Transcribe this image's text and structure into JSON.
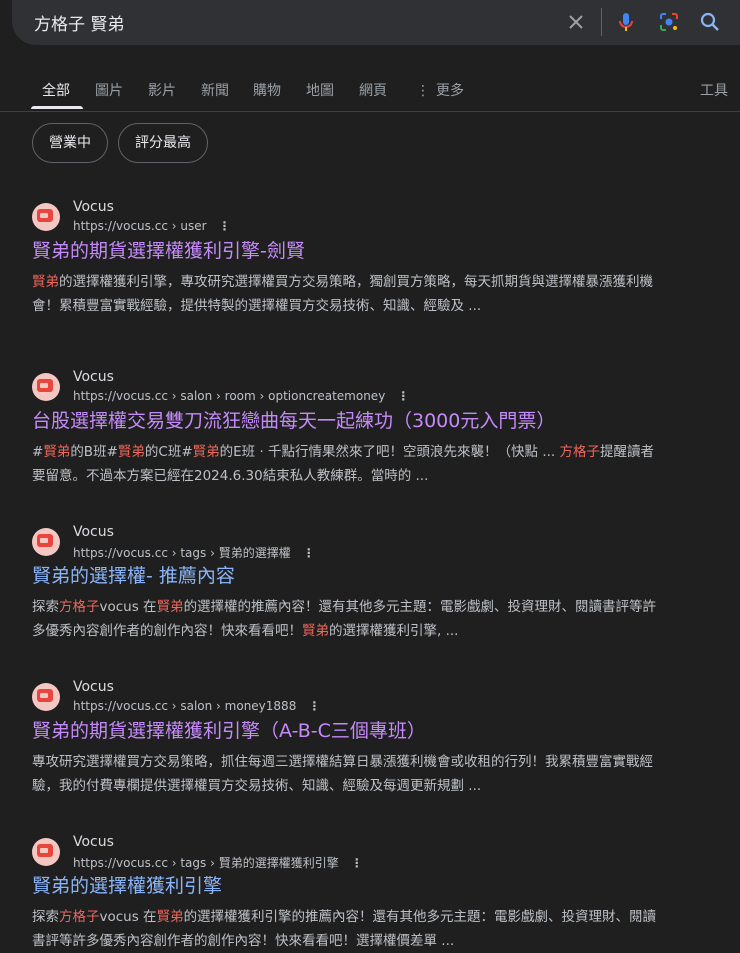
{
  "search": {
    "query": "方格子 賢弟"
  },
  "tabs": {
    "items": [
      "全部",
      "圖片",
      "影片",
      "新聞",
      "購物",
      "地圖",
      "網頁"
    ],
    "more": "更多",
    "tools": "工具"
  },
  "chips": [
    "營業中",
    "評分最高"
  ],
  "results": [
    {
      "site": "Vocus",
      "url": "https://vocus.cc › user",
      "title": "賢弟的期貨選擇權獲利引擎-劍賢",
      "snippet_parts": [
        {
          "t": "賢弟",
          "hl": true
        },
        {
          "t": "的選擇權獲利引擎，專攻研究選擇權買方交易策略，獨創買方策略，每天抓期貨與選擇權暴漲獲利機會！累積豐富實戰經驗，提供特製的選擇權買方交易技術、知識、經驗及 ...",
          "hl": false
        }
      ]
    },
    {
      "site": "Vocus",
      "url": "https://vocus.cc › salon › room › optioncreatemoney",
      "title": "台股選擇權交易雙刀流狂戀曲每天一起練功（3000元入門票）",
      "snippet_parts": [
        {
          "t": "#",
          "hl": false
        },
        {
          "t": "賢弟",
          "hl": true
        },
        {
          "t": "的B班#",
          "hl": false
        },
        {
          "t": "賢弟",
          "hl": true
        },
        {
          "t": "的C班#",
          "hl": false
        },
        {
          "t": "賢弟",
          "hl": true
        },
        {
          "t": "的E班 · 千點行情果然來了吧！空頭浪先來襲！（快點 ... ",
          "hl": false
        },
        {
          "t": "方格子",
          "hl": true
        },
        {
          "t": "提醒讀者要留意。不過本方案已經在2024.6.30結束私人教練群。當時的 ...",
          "hl": false
        }
      ]
    },
    {
      "site": "Vocus",
      "url": "https://vocus.cc › tags › 賢弟的選擇權",
      "title": "賢弟的選擇權- 推薦內容",
      "snippet_parts": [
        {
          "t": "探索",
          "hl": false
        },
        {
          "t": "方格子",
          "hl": true
        },
        {
          "t": "vocus 在",
          "hl": false
        },
        {
          "t": "賢弟",
          "hl": true
        },
        {
          "t": "的選擇權的推薦內容！還有其他多元主題：電影戲劇、投資理財、閱讀書評等許多優秀內容創作者的創作內容！快來看看吧！",
          "hl": false
        },
        {
          "t": "賢弟",
          "hl": true
        },
        {
          "t": "的選擇權獲利引擎, ...",
          "hl": false
        }
      ]
    },
    {
      "site": "Vocus",
      "url": "https://vocus.cc › salon › money1888",
      "title": "賢弟的期貨選擇權獲利引擎（A-B-C三個專班）",
      "snippet_parts": [
        {
          "t": "專攻研究選擇權買方交易策略，抓住每週三選擇權結算日暴漲獲利機會或收租的行列！我累積豐富實戰經驗，我的付費專欄提供選擇權買方交易技術、知識、經驗及每週更新規劃 ...",
          "hl": false
        }
      ]
    },
    {
      "site": "Vocus",
      "url": "https://vocus.cc › tags › 賢弟的選擇權獲利引擎",
      "title": "賢弟的選擇權獲利引擎",
      "snippet_parts": [
        {
          "t": "探索",
          "hl": false
        },
        {
          "t": "方格子",
          "hl": true
        },
        {
          "t": "vocus 在",
          "hl": false
        },
        {
          "t": "賢弟",
          "hl": true
        },
        {
          "t": "的選擇權獲利引擎的推薦內容！還有其他多元主題：電影戲劇、投資理財、閱讀書評等許多優秀內容創作者的創作內容！快來看看吧！選擇權價差單 ...",
          "hl": false
        }
      ]
    }
  ],
  "colors": {
    "background": "#1f1f1f",
    "visited_link": "#c58af9",
    "unvisited_link": "#8ab4f8",
    "highlight": "#ee675c"
  }
}
